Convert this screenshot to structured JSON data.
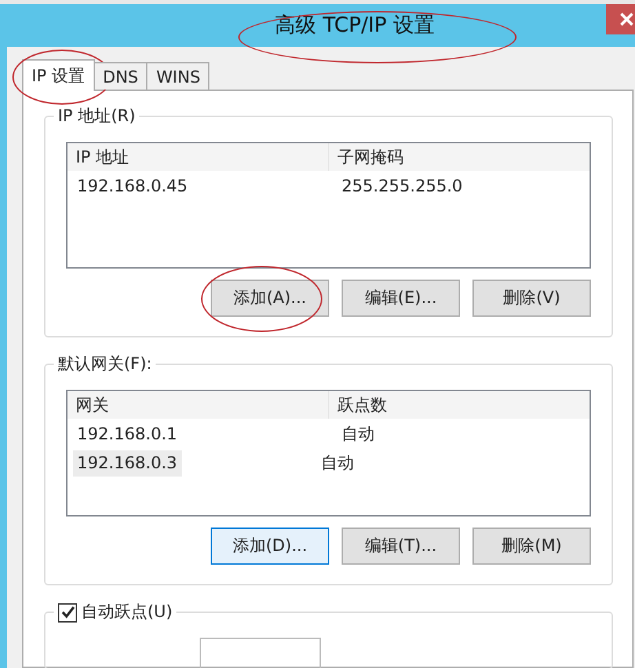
{
  "window": {
    "title": "高级 TCP/IP 设置",
    "title_circled": true
  },
  "tabs": [
    {
      "label": "IP 设置",
      "selected": true,
      "circled": true
    },
    {
      "label": "DNS",
      "selected": false,
      "circled": false
    },
    {
      "label": "WINS",
      "selected": false,
      "circled": false
    }
  ],
  "ip_group": {
    "label": "IP 地址(R)",
    "columns": [
      "IP 地址",
      "子网掩码"
    ],
    "rows": [
      {
        "cells": [
          "192.168.0.45",
          "255.255.255.0"
        ],
        "selected": false
      }
    ],
    "buttons": [
      {
        "label": "添加(A)...",
        "circled": true,
        "focused": false
      },
      {
        "label": "编辑(E)...",
        "circled": false,
        "focused": false
      },
      {
        "label": "删除(V)",
        "circled": false,
        "focused": false
      }
    ]
  },
  "gateway_group": {
    "label": "默认网关(F):",
    "columns": [
      "网关",
      "跃点数"
    ],
    "rows": [
      {
        "cells": [
          "192.168.0.1",
          "自动"
        ],
        "selected": false
      },
      {
        "cells": [
          "192.168.0.3",
          "自动"
        ],
        "selected": true
      }
    ],
    "buttons": [
      {
        "label": "添加(D)...",
        "circled": false,
        "focused": true
      },
      {
        "label": "编辑(T)...",
        "circled": false,
        "focused": false
      },
      {
        "label": "删除(M)",
        "circled": false,
        "focused": false
      }
    ]
  },
  "metric": {
    "label": "自动跃点(U)",
    "checked": true
  }
}
